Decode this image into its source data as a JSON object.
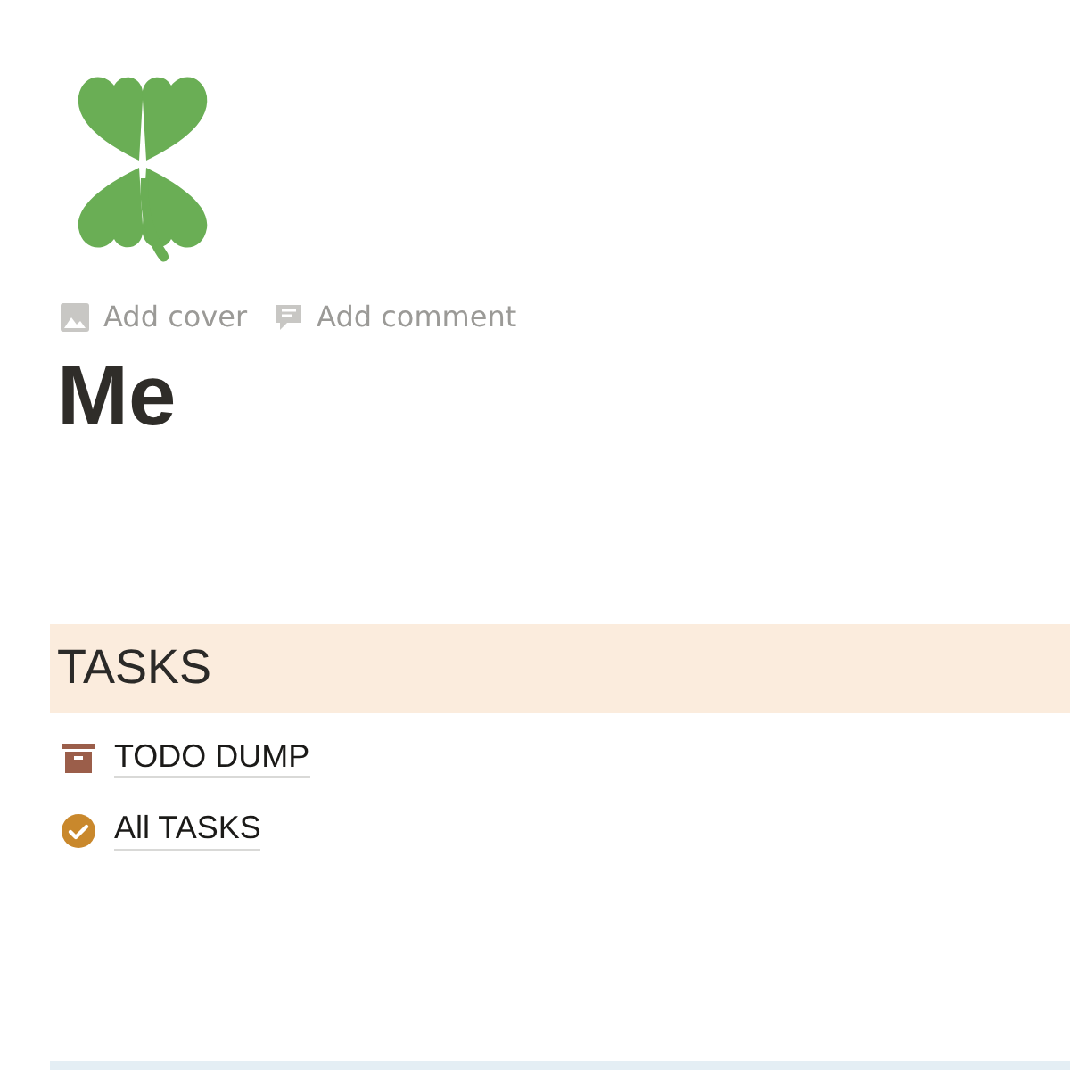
{
  "page_actions": [
    {
      "kind": "cover",
      "label": "Add cover"
    },
    {
      "kind": "comment",
      "label": "Add comment"
    }
  ],
  "title": "Me",
  "section": {
    "heading": "TASKS",
    "links": [
      {
        "kind": "archive",
        "label": "TODO DUMP"
      },
      {
        "kind": "check",
        "label": "All TASKS"
      }
    ]
  }
}
